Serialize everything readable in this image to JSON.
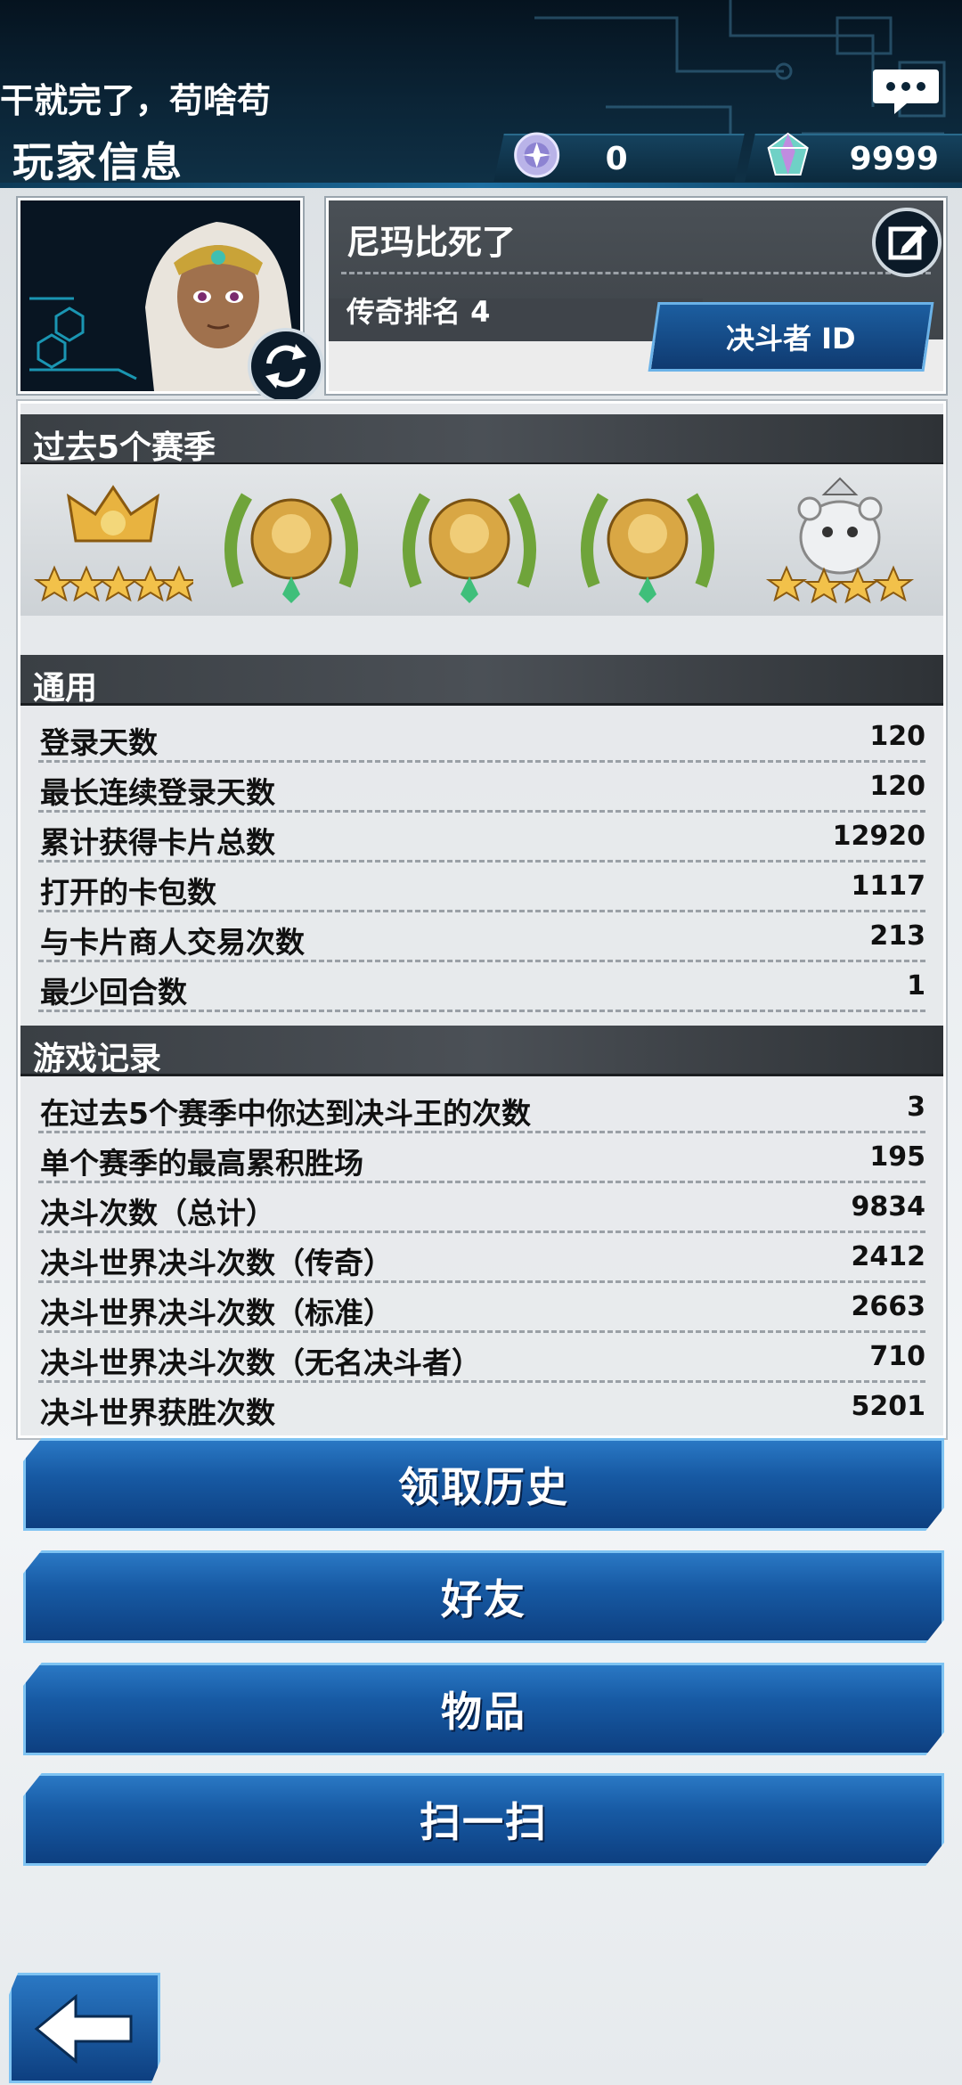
{
  "header": {
    "marquee": "干就完了，苟啥苟",
    "title": "玩家信息",
    "chat_icon": "speech-bubble-icon",
    "currencies": [
      {
        "icon": "orb-gem-icon",
        "value": "0"
      },
      {
        "icon": "crystal-gem-icon",
        "value": "9999"
      }
    ]
  },
  "profile": {
    "name": "尼玛比死了",
    "rank": "传奇排名 4",
    "duelist_id_label": "决斗者 ID"
  },
  "seasons": {
    "heading": "过去5个赛季",
    "medals": [
      "legend-crown-medal-icon",
      "laurel-lion-medal-icon",
      "laurel-lion-medal-icon",
      "laurel-lion-medal-icon",
      "bear-medal-icon"
    ]
  },
  "general": {
    "heading": "通用",
    "rows": [
      {
        "label": "登录天数",
        "value": "120"
      },
      {
        "label": "最长连续登录天数",
        "value": "120"
      },
      {
        "label": "累计获得卡片总数",
        "value": "12920"
      },
      {
        "label": "打开的卡包数",
        "value": "1117"
      },
      {
        "label": "与卡片商人交易次数",
        "value": "213"
      },
      {
        "label": "最少回合数",
        "value": "1"
      }
    ]
  },
  "records": {
    "heading": "游戏记录",
    "rows": [
      {
        "label": "在过去5个赛季中你达到决斗王的次数",
        "value": "3"
      },
      {
        "label": "单个赛季的最高累积胜场",
        "value": "195"
      },
      {
        "label": "决斗次数（总计）",
        "value": "9834"
      },
      {
        "label": "决斗世界决斗次数（传奇）",
        "value": "2412"
      },
      {
        "label": "决斗世界决斗次数（标准）",
        "value": "2663"
      },
      {
        "label": "决斗世界决斗次数（无名决斗者）",
        "value": "710"
      },
      {
        "label": "决斗世界获胜次数",
        "value": "5201"
      }
    ]
  },
  "buttons": {
    "history": "领取历史",
    "friends": "好友",
    "items": "物品",
    "scan": "扫一扫"
  }
}
